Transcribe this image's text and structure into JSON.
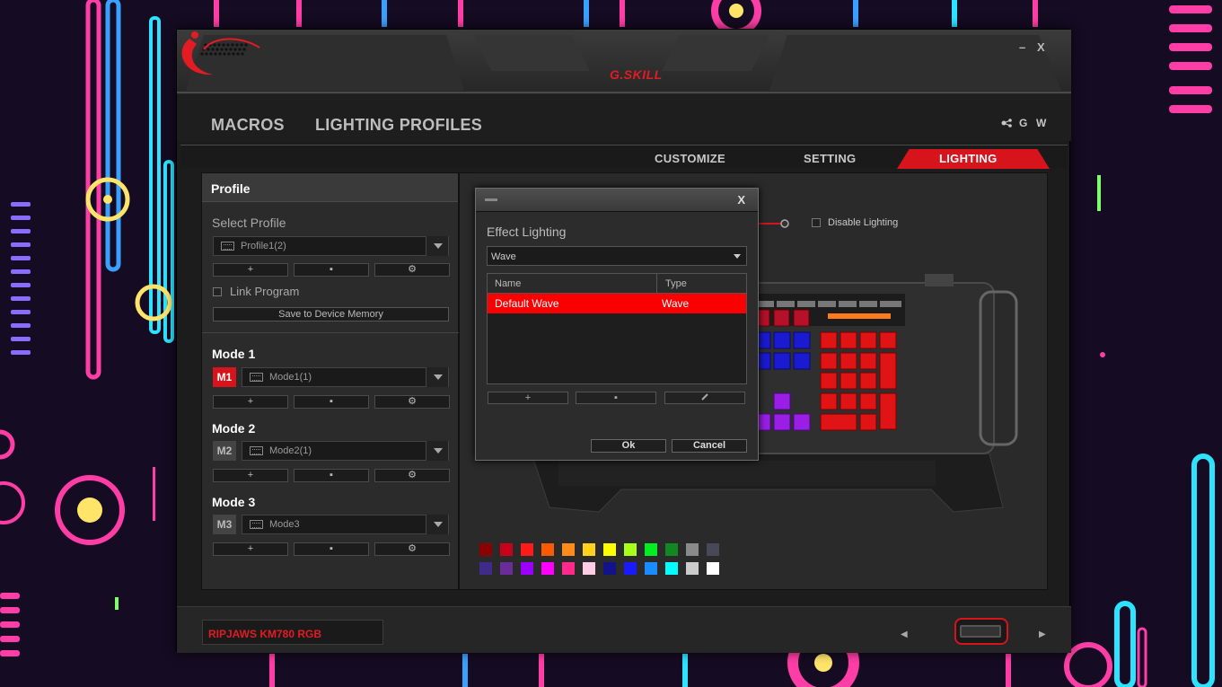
{
  "window": {
    "minimize_label": "–",
    "close_label": "X",
    "brand": "G.SKILL"
  },
  "nav": {
    "macros": "MACROS",
    "lighting_profiles": "LIGHTING PROFILES",
    "right_g": "G",
    "right_w": "W"
  },
  "tabs": {
    "customize": "CUSTOMIZE",
    "setting": "SETTING",
    "lighting": "LIGHTING"
  },
  "profile": {
    "header": "Profile",
    "select_label": "Select Profile",
    "selected": "Profile1(2)",
    "link_program": "Link Program",
    "save_button": "Save to Device Memory"
  },
  "buttons": {
    "add": "+",
    "delete": "▪",
    "settings": "⚙"
  },
  "modes": [
    {
      "label": "Mode 1",
      "badge": "M1",
      "value": "Mode1(1)",
      "active": true
    },
    {
      "label": "Mode 2",
      "badge": "M2",
      "value": "Mode2(1)",
      "active": false
    },
    {
      "label": "Mode 3",
      "badge": "M3",
      "value": "Mode3",
      "active": false
    }
  ],
  "lighting": {
    "disable_label": "Disable Lighting"
  },
  "palette": {
    "row1": [
      "#8b0000",
      "#c8001a",
      "#ff1a1a",
      "#ff5a00",
      "#ff8c1a",
      "#ffd21a",
      "#ffff00",
      "#a8ff1a",
      "#00ee22",
      "#118822",
      "#8a8a8a",
      "#484858"
    ],
    "row2": [
      "#3f2c8a",
      "#6a2c9a",
      "#9b00ff",
      "#ff00ff",
      "#ff2a8a",
      "#ffcce6",
      "#12128a",
      "#1a1aff",
      "#1a8cff",
      "#00ffff",
      "#cccccc",
      "#ffffff"
    ]
  },
  "dialog": {
    "close_label": "X",
    "title": "Effect Lighting",
    "effect_value": "Wave",
    "col_name": "Name",
    "col_type": "Type",
    "rows": [
      {
        "name": "Default Wave",
        "type": "Wave"
      }
    ],
    "ok": "Ok",
    "cancel": "Cancel"
  },
  "device": {
    "name": "RIPJAWS KM780 RGB"
  },
  "colors": {
    "accent": "#d7141c",
    "selection": "#fa0000"
  }
}
